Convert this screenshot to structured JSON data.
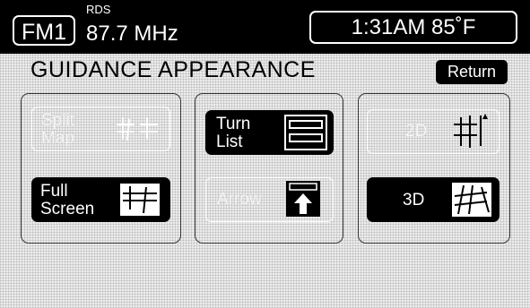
{
  "status_bar": {
    "band": "FM1",
    "rds_label": "RDS",
    "frequency": "87.7 MHz",
    "clock": "1:31AM 85˚F"
  },
  "page": {
    "title": "GUIDANCE APPEARANCE",
    "return_label": "Return"
  },
  "buttons": {
    "split_map": {
      "line1": "Split",
      "line2": "Map",
      "state": "disabled"
    },
    "full_screen": {
      "line1": "Full",
      "line2": "Screen",
      "state": "selected"
    },
    "turn_list": {
      "line1": "Turn",
      "line2": "List",
      "state": "selected"
    },
    "arrow": {
      "label": "Arrow",
      "state": "disabled"
    },
    "2d": {
      "label": "2D",
      "state": "disabled"
    },
    "3d": {
      "label": "3D",
      "state": "selected"
    }
  }
}
